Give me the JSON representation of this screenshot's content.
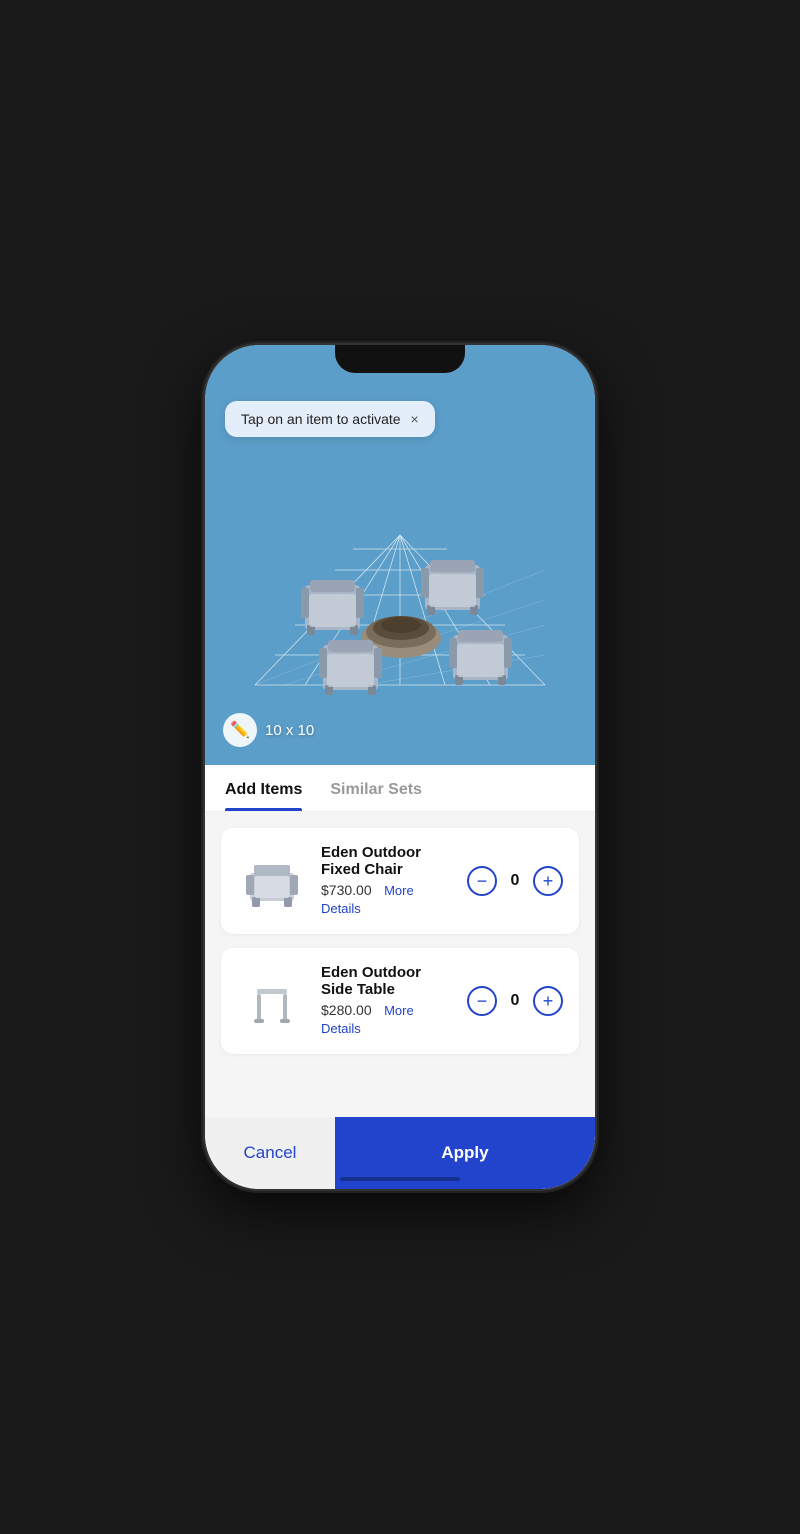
{
  "tooltip": {
    "text": "Tap on an item to activate",
    "close_label": "×"
  },
  "viewport": {
    "dimensions": "10 x 10",
    "edit_icon": "✏"
  },
  "tabs": [
    {
      "id": "add-items",
      "label": "Add Items",
      "active": true
    },
    {
      "id": "similar-sets",
      "label": "Similar Sets",
      "active": false
    }
  ],
  "items": [
    {
      "id": "item-1",
      "name": "Eden Outdoor Fixed Chair",
      "price": "$730.00",
      "details_label": "More Details",
      "quantity": "0"
    },
    {
      "id": "item-2",
      "name": "Eden Outdoor Side Table",
      "price": "$280.00",
      "details_label": "More Details",
      "quantity": "0"
    }
  ],
  "actions": {
    "cancel_label": "Cancel",
    "apply_label": "Apply"
  }
}
